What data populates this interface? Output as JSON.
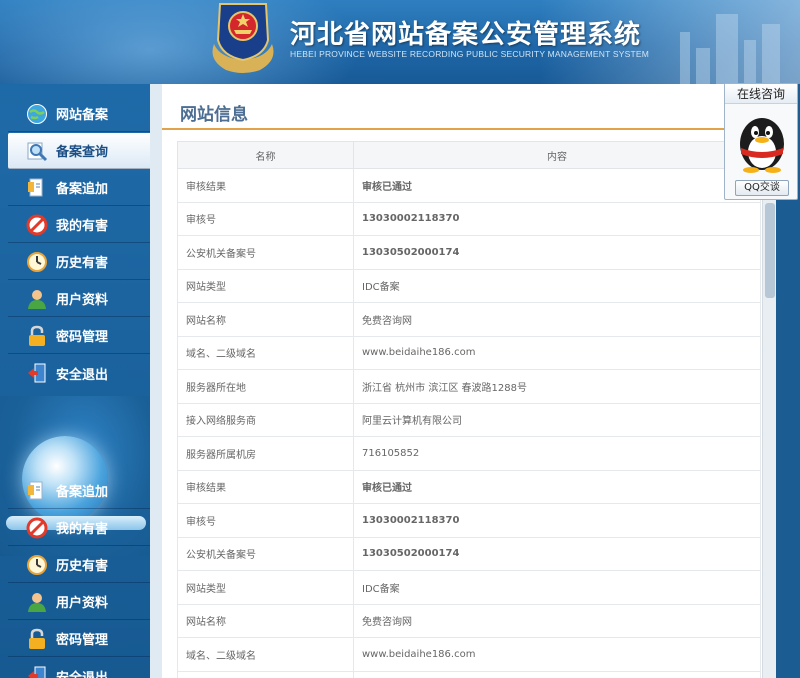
{
  "header": {
    "title": "河北省网站备案公安管理系统",
    "subtitle": "HEBEI PROVINCE WEBSITE RECORDING PUBLIC SECURITY MANAGEMENT SYSTEM"
  },
  "sidebar": {
    "items": [
      {
        "label": "网站备案",
        "icon": "globe-icon",
        "active": false
      },
      {
        "label": "备案查询",
        "icon": "magnifier-icon",
        "active": true
      },
      {
        "label": "备案追加",
        "icon": "document-add-icon",
        "active": false
      },
      {
        "label": "我的有害",
        "icon": "prohibited-icon",
        "active": false
      },
      {
        "label": "历史有害",
        "icon": "clock-icon",
        "active": false
      },
      {
        "label": "用户资料",
        "icon": "user-icon",
        "active": false
      },
      {
        "label": "密码管理",
        "icon": "lock-icon",
        "active": false
      },
      {
        "label": "安全退出",
        "icon": "exit-icon",
        "active": false
      }
    ],
    "items_lower": [
      {
        "label": "备案追加",
        "icon": "document-add-icon"
      },
      {
        "label": "我的有害",
        "icon": "prohibited-icon"
      },
      {
        "label": "历史有害",
        "icon": "clock-icon"
      },
      {
        "label": "用户资料",
        "icon": "user-icon"
      },
      {
        "label": "密码管理",
        "icon": "lock-icon"
      },
      {
        "label": "安全退出",
        "icon": "exit-icon"
      }
    ]
  },
  "main": {
    "title": "网站信息",
    "table": {
      "headers": [
        "名称",
        "内容"
      ],
      "rows": [
        {
          "name": "审核结果",
          "value": "审核已通过",
          "style": "green"
        },
        {
          "name": "审核号",
          "value": "13030002118370",
          "style": "red"
        },
        {
          "name": "公安机关备案号",
          "value": "13030502000174",
          "style": "red"
        },
        {
          "name": "网站类型",
          "value": "IDC备案",
          "style": "normal"
        },
        {
          "name": "网站名称",
          "value": "免费咨询网",
          "style": "normal"
        },
        {
          "name": "域名、二级域名",
          "value": "www.beidaihe186.com",
          "style": "normal"
        },
        {
          "name": "服务器所在地",
          "value": "浙江省 杭州市 滨江区 春波路1288号",
          "style": "normal"
        },
        {
          "name": "接入网络服务商",
          "value": "阿里云计算机有限公司",
          "style": "normal"
        },
        {
          "name": "服务器所属机房",
          "value": "716105852",
          "style": "normal"
        },
        {
          "name": "审核结果",
          "value": "审核已通过",
          "style": "green"
        },
        {
          "name": "审核号",
          "value": "13030002118370",
          "style": "red"
        },
        {
          "name": "公安机关备案号",
          "value": "13030502000174",
          "style": "red"
        },
        {
          "name": "网站类型",
          "value": "IDC备案",
          "style": "normal"
        },
        {
          "name": "网站名称",
          "value": "免费咨询网",
          "style": "normal"
        },
        {
          "name": "域名、二级域名",
          "value": "www.beidaihe186.com",
          "style": "normal"
        },
        {
          "name": "",
          "value": "",
          "style": "normal"
        }
      ]
    }
  },
  "qq_widget": {
    "title": "在线咨询",
    "button_label": "QQ交谈",
    "avatar_icon": "qq-penguin-icon"
  },
  "colors": {
    "accent_orange": "#e2a24a",
    "status_green": "#139a2c",
    "number_red": "#d01d1d",
    "sidebar_blue": "#1b5d93"
  }
}
